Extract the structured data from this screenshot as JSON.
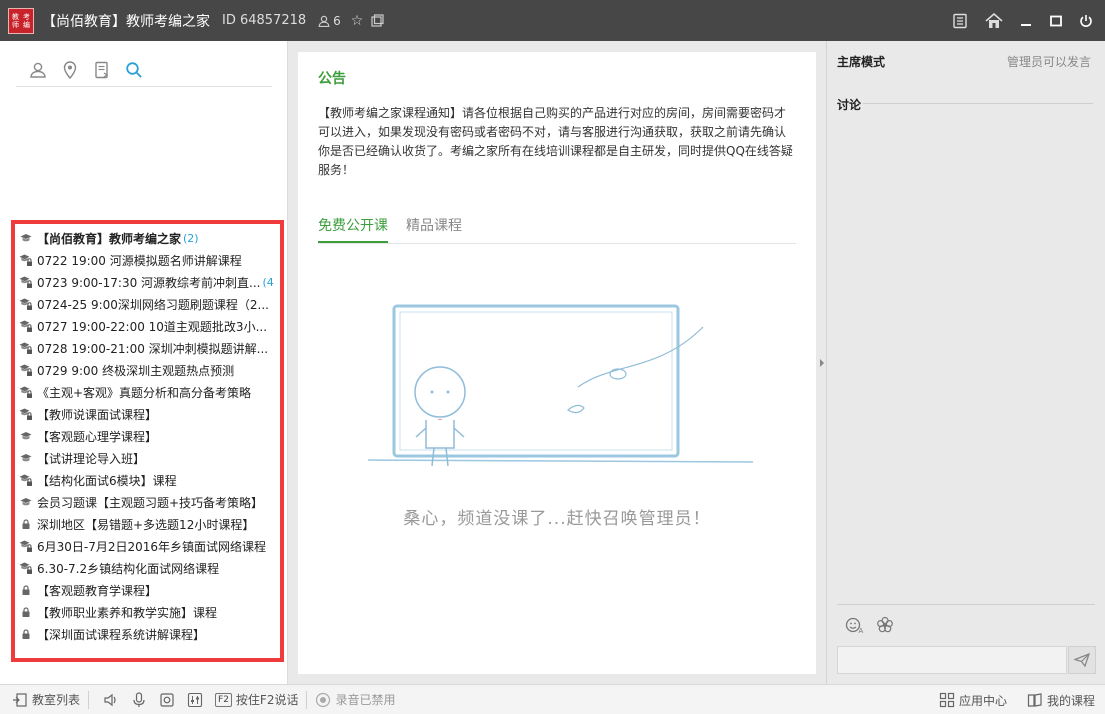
{
  "window": {
    "logo_chars": [
      "教",
      "考",
      "师",
      "编"
    ],
    "title": "【尚佰教育】教师考编之家",
    "room_id": "ID  64857218",
    "user_count": "6"
  },
  "left_toolbar": {
    "icons": [
      "user-icon",
      "location-icon",
      "note-icon",
      "search-icon"
    ]
  },
  "rooms": [
    {
      "label": "【尚佰教育】教师考编之家",
      "count": "(2)",
      "icon": "graduation-cap-icon",
      "type": "parent"
    },
    {
      "label": "0722 19:00 河源模拟题名师讲解课程",
      "count": "",
      "icon": "cap-lock-icon",
      "type": "child"
    },
    {
      "label": "0723 9:00-17:30 河源教综考前冲刺直...",
      "count": "(4",
      "icon": "cap-lock-icon",
      "type": "child"
    },
    {
      "label": "0724-25 9:00深圳网络习题刷题课程（2...",
      "count": "",
      "icon": "cap-lock-icon",
      "type": "child"
    },
    {
      "label": "0727 19:00-22:00 10道主观题批改3小...",
      "count": "",
      "icon": "cap-lock-icon",
      "type": "child"
    },
    {
      "label": "0728 19:00-21:00 深圳冲刺模拟题讲解...",
      "count": "",
      "icon": "cap-lock-icon",
      "type": "child"
    },
    {
      "label": "0729 9:00 终极深圳主观题热点预测",
      "count": "",
      "icon": "cap-lock-icon",
      "type": "child"
    },
    {
      "label": "《主观+客观》真题分析和高分备考策略",
      "count": "",
      "icon": "cap-lock-icon",
      "type": "child"
    },
    {
      "label": "【教师说课面试课程】",
      "count": "",
      "icon": "cap-lock-icon",
      "type": "child"
    },
    {
      "label": "【客观题心理学课程】",
      "count": "",
      "icon": "graduation-cap-icon",
      "type": "child"
    },
    {
      "label": "【试讲理论导入班】",
      "count": "",
      "icon": "graduation-cap-icon",
      "type": "child"
    },
    {
      "label": "【结构化面试6模块】课程",
      "count": "",
      "icon": "cap-lock-icon",
      "type": "child"
    },
    {
      "label": "会员习题课【主观题习题+技巧备考策略】",
      "count": "",
      "icon": "graduation-cap-icon",
      "type": "child"
    },
    {
      "label": "深圳地区【易错题+多选题12小时课程】",
      "count": "",
      "icon": "lock-icon",
      "type": "child"
    },
    {
      "label": "6月30日-7月2日2016年乡镇面试网络课程",
      "count": "",
      "icon": "cap-lock-icon",
      "type": "child"
    },
    {
      "label": "6.30-7.2乡镇结构化面试网络课程",
      "count": "",
      "icon": "cap-lock-icon",
      "type": "child"
    },
    {
      "label": "【客观题教育学课程】",
      "count": "",
      "icon": "lock-icon",
      "type": "child"
    },
    {
      "label": "【教师职业素养和教学实施】课程",
      "count": "",
      "icon": "lock-icon",
      "type": "child"
    },
    {
      "label": "【深圳面试课程系统讲解课程】",
      "count": "",
      "icon": "lock-icon",
      "type": "child"
    }
  ],
  "notice": {
    "title": "公告",
    "body": "【教师考编之家课程通知】请各位根据自己购买的产品进行对应的房间，房间需要密码才可以进入，如果发现没有密码或者密码不对，请与客服进行沟通获取，获取之前请先确认你是否已经确认收货了。考编之家所有在线培训课程都是自主研发，同时提供QQ在线答疑服务！"
  },
  "tabs": [
    {
      "label": "免费公开课",
      "active": true
    },
    {
      "label": "精品课程",
      "active": false
    }
  ],
  "empty_state": {
    "message": "桑心，频道没课了...赶快召唤管理员！"
  },
  "right_panel": {
    "mode_label": "主席模式",
    "mode_status": "管理员可以发言",
    "discussion_label": "讨论",
    "input_placeholder": ""
  },
  "bottombar": {
    "room_list": "教室列表",
    "f2_key": "F2",
    "push_to_talk": "按住F2说话",
    "recording": "录音已禁用",
    "app_center": "应用中心",
    "my_courses": "我的课程"
  },
  "colors": {
    "accent_green": "#3d9e3d",
    "highlight_red": "#ef3b3b",
    "titlebar": "#474747",
    "count_blue": "#2aa0d8"
  }
}
